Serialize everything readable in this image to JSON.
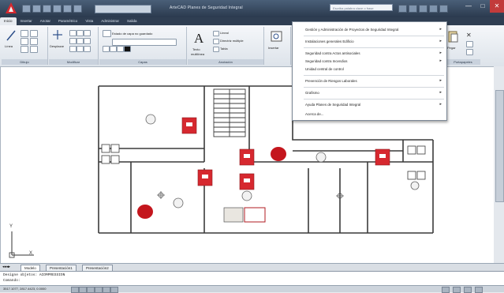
{
  "window": {
    "title": "ArteCAD Planes de Seguridad Integral",
    "search_placeholder": "Escriba palabra clave o frase",
    "controls": [
      "—",
      "□",
      "✕"
    ]
  },
  "menu_tabs": [
    {
      "label": "Inicio",
      "active": true
    },
    {
      "label": "Insertar",
      "active": false
    },
    {
      "label": "Anotar",
      "active": false
    },
    {
      "label": "Paramétrico",
      "active": false
    },
    {
      "label": "Vista",
      "active": false
    },
    {
      "label": "Administrar",
      "active": false
    },
    {
      "label": "Salida",
      "active": false
    }
  ],
  "ribbon": {
    "panels": [
      {
        "caption": "Dibujo"
      },
      {
        "caption": "Modificar"
      },
      {
        "caption": "Capas"
      },
      {
        "caption": "Anotación"
      },
      {
        "caption": "Portapapeles"
      }
    ],
    "labels": {
      "linea": "Línea",
      "desplazar": "Desplazar",
      "estado_capa": "Estado de capa no guardado",
      "texto": "Texto",
      "texto_sub": "multilínea",
      "lineal": "Lineal",
      "directriz": "Directriz múltiple",
      "tabla": "Tabla",
      "insertar": "Insertar",
      "pegar": "Pegar"
    }
  },
  "dropdown": {
    "items": [
      {
        "label": "Gestión y Administración de Proyectos de Seguridad Integral",
        "has_submenu": true
      },
      {
        "label": "Instalaciones generales Edificio",
        "has_submenu": true
      },
      {
        "label": "Seguridad contra Actos antisociales",
        "has_submenu": true
      },
      {
        "label": "Seguridad contra Incendios",
        "has_submenu": true
      },
      {
        "label": "Unidad central de control",
        "has_submenu": false
      },
      {
        "label": "Prevención de Riesgos Laborales",
        "has_submenu": true
      },
      {
        "label": "Grafismo",
        "has_submenu": true
      },
      {
        "label": "Ayuda Planes de Seguridad Integral",
        "has_submenu": true
      },
      {
        "label": "Acerca de...",
        "has_submenu": false
      }
    ]
  },
  "layout_tabs": [
    {
      "label": "Modelo",
      "active": true
    },
    {
      "label": "Presentación1",
      "active": false
    },
    {
      "label": "Presentación2",
      "active": false
    }
  ],
  "command": {
    "history": "Designe objetos: ACOMPRESSION",
    "prompt": "Comando:"
  },
  "status": {
    "coords": "3517.1077, 2817.4423, 0.0000"
  },
  "ucs": {
    "x_label": "X",
    "y_label": "Y"
  },
  "colors": {
    "accent_red": "#d6282f",
    "titlebar": "#2b3a4e",
    "wall": "#3a3a3a"
  }
}
